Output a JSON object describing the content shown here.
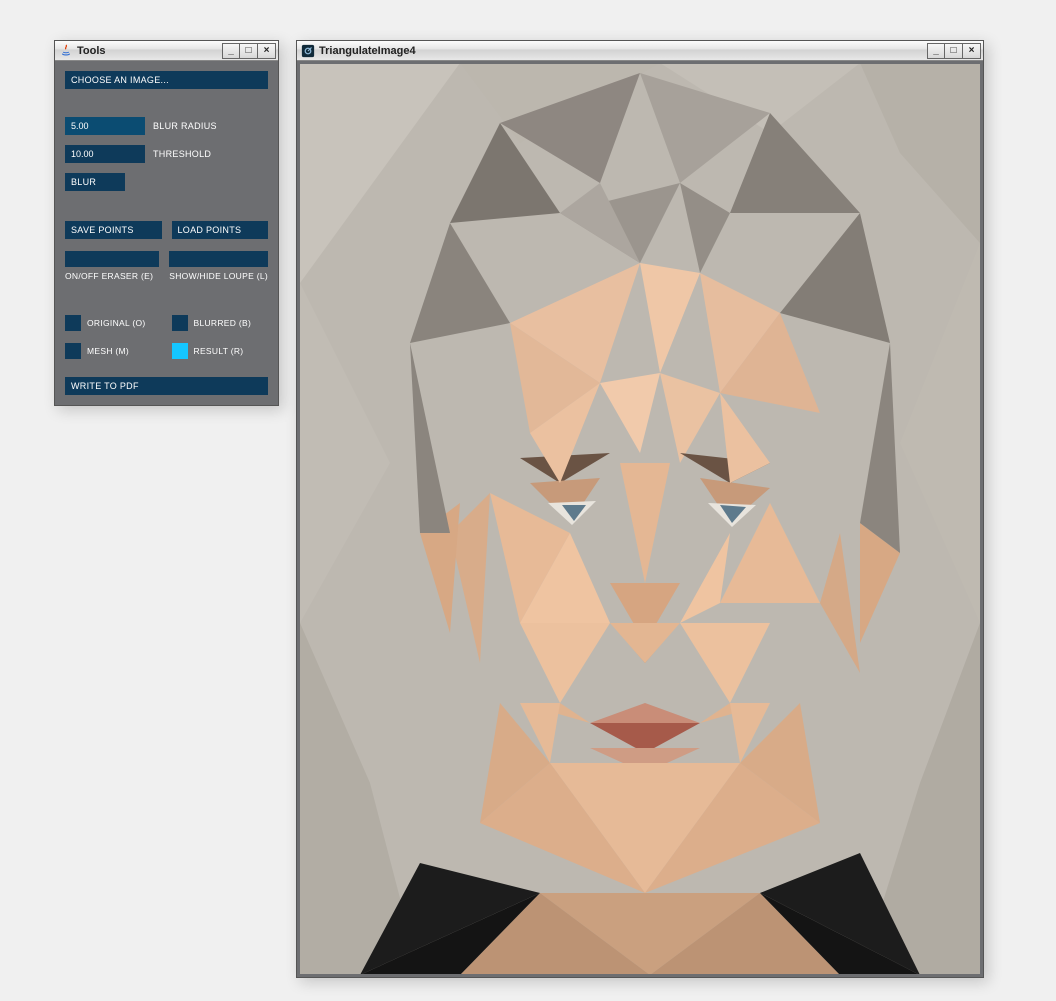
{
  "tools_window": {
    "title": "Tools",
    "choose_image_label": "CHOOSE AN IMAGE...",
    "blur_radius": {
      "value": "5.00",
      "label": "BLUR RADIUS"
    },
    "threshold": {
      "value": "10.00",
      "label": "THRESHOLD"
    },
    "blur_button_label": "BLUR",
    "save_points_label": "SAVE POINTS",
    "load_points_label": "LOAD POINTS",
    "eraser_caption": "ON/OFF ERASER (E)",
    "loupe_caption": "SHOW/HIDE LOUPE (L)",
    "checks": {
      "original": {
        "label": "ORIGINAL (O)",
        "on": false
      },
      "blurred": {
        "label": "BLURRED (B)",
        "on": false
      },
      "mesh": {
        "label": "MESH (M)",
        "on": false
      },
      "result": {
        "label": "RESULT (R)",
        "on": true
      }
    },
    "write_pdf_label": "WRITE TO PDF"
  },
  "image_window": {
    "title": "TriangulateImage4"
  },
  "window_controls": {
    "minimize_glyph": "_",
    "maximize_glyph": "□",
    "close_glyph": "×"
  }
}
